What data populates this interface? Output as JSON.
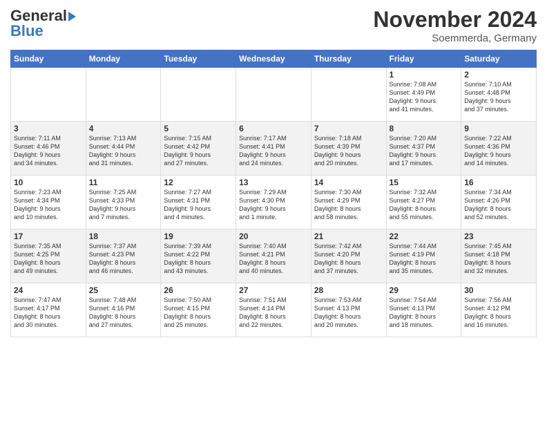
{
  "header": {
    "logo_line1": "General",
    "logo_line2": "Blue",
    "month": "November 2024",
    "location": "Soemmerda, Germany"
  },
  "weekdays": [
    "Sunday",
    "Monday",
    "Tuesday",
    "Wednesday",
    "Thursday",
    "Friday",
    "Saturday"
  ],
  "weeks": [
    [
      {
        "day": "",
        "info": ""
      },
      {
        "day": "",
        "info": ""
      },
      {
        "day": "",
        "info": ""
      },
      {
        "day": "",
        "info": ""
      },
      {
        "day": "",
        "info": ""
      },
      {
        "day": "1",
        "info": "Sunrise: 7:08 AM\nSunset: 4:49 PM\nDaylight: 9 hours\nand 41 minutes."
      },
      {
        "day": "2",
        "info": "Sunrise: 7:10 AM\nSunset: 4:48 PM\nDaylight: 9 hours\nand 37 minutes."
      }
    ],
    [
      {
        "day": "3",
        "info": "Sunrise: 7:11 AM\nSunset: 4:46 PM\nDaylight: 9 hours\nand 34 minutes."
      },
      {
        "day": "4",
        "info": "Sunrise: 7:13 AM\nSunset: 4:44 PM\nDaylight: 9 hours\nand 31 minutes."
      },
      {
        "day": "5",
        "info": "Sunrise: 7:15 AM\nSunset: 4:42 PM\nDaylight: 9 hours\nand 27 minutes."
      },
      {
        "day": "6",
        "info": "Sunrise: 7:17 AM\nSunset: 4:41 PM\nDaylight: 9 hours\nand 24 minutes."
      },
      {
        "day": "7",
        "info": "Sunrise: 7:18 AM\nSunset: 4:39 PM\nDaylight: 9 hours\nand 20 minutes."
      },
      {
        "day": "8",
        "info": "Sunrise: 7:20 AM\nSunset: 4:37 PM\nDaylight: 9 hours\nand 17 minutes."
      },
      {
        "day": "9",
        "info": "Sunrise: 7:22 AM\nSunset: 4:36 PM\nDaylight: 9 hours\nand 14 minutes."
      }
    ],
    [
      {
        "day": "10",
        "info": "Sunrise: 7:23 AM\nSunset: 4:34 PM\nDaylight: 9 hours\nand 10 minutes."
      },
      {
        "day": "11",
        "info": "Sunrise: 7:25 AM\nSunset: 4:33 PM\nDaylight: 9 hours\nand 7 minutes."
      },
      {
        "day": "12",
        "info": "Sunrise: 7:27 AM\nSunset: 4:31 PM\nDaylight: 9 hours\nand 4 minutes."
      },
      {
        "day": "13",
        "info": "Sunrise: 7:29 AM\nSunset: 4:30 PM\nDaylight: 9 hours\nand 1 minute."
      },
      {
        "day": "14",
        "info": "Sunrise: 7:30 AM\nSunset: 4:29 PM\nDaylight: 8 hours\nand 58 minutes."
      },
      {
        "day": "15",
        "info": "Sunrise: 7:32 AM\nSunset: 4:27 PM\nDaylight: 8 hours\nand 55 minutes."
      },
      {
        "day": "16",
        "info": "Sunrise: 7:34 AM\nSunset: 4:26 PM\nDaylight: 8 hours\nand 52 minutes."
      }
    ],
    [
      {
        "day": "17",
        "info": "Sunrise: 7:35 AM\nSunset: 4:25 PM\nDaylight: 8 hours\nand 49 minutes."
      },
      {
        "day": "18",
        "info": "Sunrise: 7:37 AM\nSunset: 4:23 PM\nDaylight: 8 hours\nand 46 minutes."
      },
      {
        "day": "19",
        "info": "Sunrise: 7:39 AM\nSunset: 4:22 PM\nDaylight: 8 hours\nand 43 minutes."
      },
      {
        "day": "20",
        "info": "Sunrise: 7:40 AM\nSunset: 4:21 PM\nDaylight: 8 hours\nand 40 minutes."
      },
      {
        "day": "21",
        "info": "Sunrise: 7:42 AM\nSunset: 4:20 PM\nDaylight: 8 hours\nand 37 minutes."
      },
      {
        "day": "22",
        "info": "Sunrise: 7:44 AM\nSunset: 4:19 PM\nDaylight: 8 hours\nand 35 minutes."
      },
      {
        "day": "23",
        "info": "Sunrise: 7:45 AM\nSunset: 4:18 PM\nDaylight: 8 hours\nand 32 minutes."
      }
    ],
    [
      {
        "day": "24",
        "info": "Sunrise: 7:47 AM\nSunset: 4:17 PM\nDaylight: 8 hours\nand 30 minutes."
      },
      {
        "day": "25",
        "info": "Sunrise: 7:48 AM\nSunset: 4:16 PM\nDaylight: 8 hours\nand 27 minutes."
      },
      {
        "day": "26",
        "info": "Sunrise: 7:50 AM\nSunset: 4:15 PM\nDaylight: 8 hours\nand 25 minutes."
      },
      {
        "day": "27",
        "info": "Sunrise: 7:51 AM\nSunset: 4:14 PM\nDaylight: 8 hours\nand 22 minutes."
      },
      {
        "day": "28",
        "info": "Sunrise: 7:53 AM\nSunset: 4:13 PM\nDaylight: 8 hours\nand 20 minutes."
      },
      {
        "day": "29",
        "info": "Sunrise: 7:54 AM\nSunset: 4:13 PM\nDaylight: 8 hours\nand 18 minutes."
      },
      {
        "day": "30",
        "info": "Sunrise: 7:56 AM\nSunset: 4:12 PM\nDaylight: 8 hours\nand 16 minutes."
      }
    ]
  ]
}
